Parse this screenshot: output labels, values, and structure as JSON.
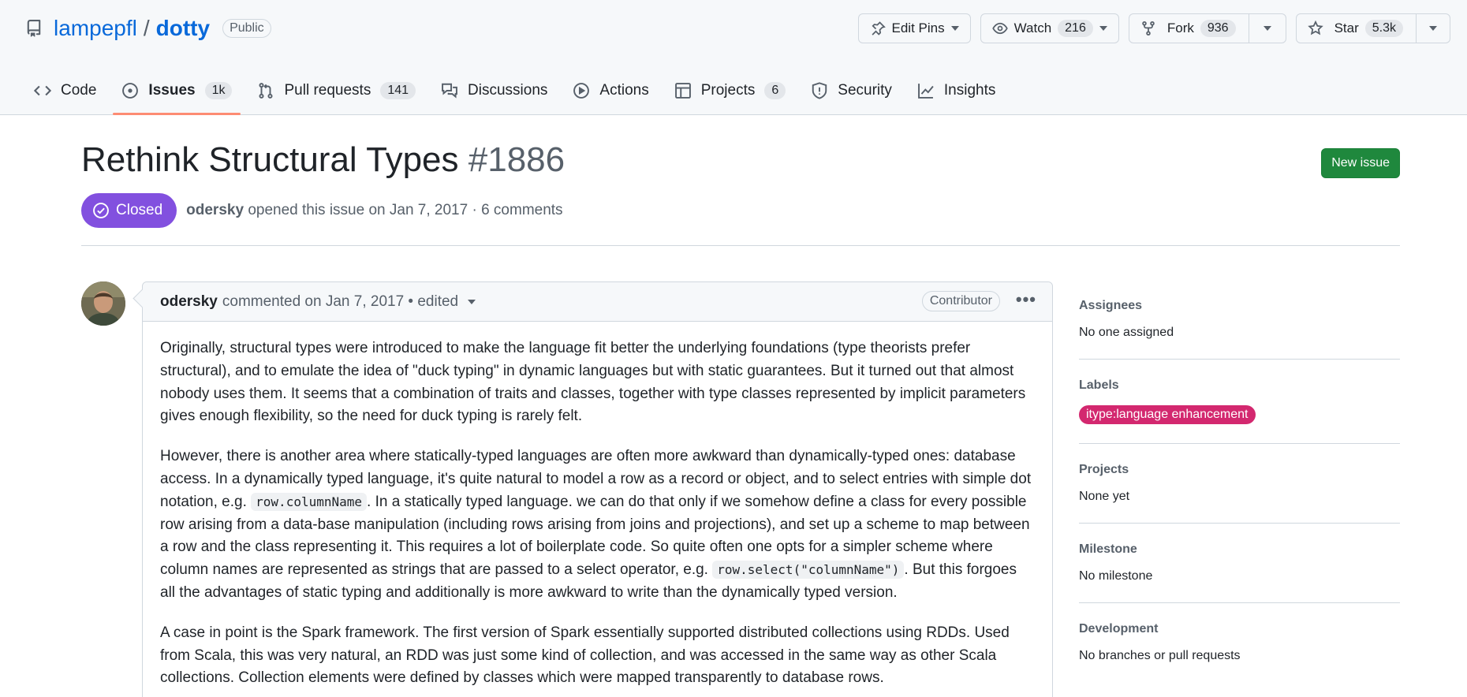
{
  "repo": {
    "owner": "lampepfl",
    "separator": "/",
    "name": "dotty",
    "visibility": "Public"
  },
  "actions": {
    "edit_pins": "Edit Pins",
    "watch_label": "Watch",
    "watch_count": "216",
    "fork_label": "Fork",
    "fork_count": "936",
    "star_label": "Star",
    "star_count": "5.3k"
  },
  "tabs": [
    {
      "label": "Code",
      "icon": "code-icon",
      "count": ""
    },
    {
      "label": "Issues",
      "icon": "issue-opened-icon",
      "count": "1k",
      "active": true
    },
    {
      "label": "Pull requests",
      "icon": "git-pull-request-icon",
      "count": "141"
    },
    {
      "label": "Discussions",
      "icon": "comment-discussion-icon",
      "count": ""
    },
    {
      "label": "Actions",
      "icon": "play-icon",
      "count": ""
    },
    {
      "label": "Projects",
      "icon": "table-icon",
      "count": "6"
    },
    {
      "label": "Security",
      "icon": "shield-icon",
      "count": ""
    },
    {
      "label": "Insights",
      "icon": "graph-icon",
      "count": ""
    }
  ],
  "issue": {
    "title": "Rethink Structural Types",
    "number": "#1886",
    "state": "Closed",
    "author": "odersky",
    "opened_text": "opened this issue on Jan 7, 2017 · 6 comments",
    "new_issue_label": "New issue"
  },
  "comment": {
    "author": "odersky",
    "meta": "commented on Jan 7, 2017 • edited",
    "role": "Contributor",
    "paragraphs": {
      "p1": "Originally, structural types were introduced to make the language fit better the underlying foundations (type theorists prefer structural), and to emulate the idea of \"duck typing\" in dynamic languages but with static guarantees. But it turned out that almost nobody uses them. It seems that a combination of traits and classes, together with type classes represented by implicit parameters gives enough flexibility, so the need for duck typing is rarely felt.",
      "p2a": "However, there is another area where statically-typed languages are often more awkward than dynamically-typed ones: database access. In a dynamically typed language, it's quite natural to model a row as a record or object, and to select entries with simple dot notation, e.g. ",
      "p2_code1": "row.columnName",
      "p2b": ". In a statically typed language. we can do that only if we somehow define a class for every possible row arising from a data-base manipulation (including rows arising from joins and projections), and set up a scheme to map between a row and the class representing it. This requires a lot of boilerplate code. So quite often one opts for a simpler scheme where column names are represented as strings that are passed to a select operator, e.g. ",
      "p2_code2": "row.select(\"columnName\")",
      "p2c": ". But this forgoes all the advantages of static typing and additionally is more awkward to write than the dynamically typed version.",
      "p3": "A case in point is the Spark framework. The first version of Spark essentially supported distributed collections using RDDs. Used from Scala, this was very natural, an RDD was just some kind of collection, and was accessed in the same way as other Scala collections. Collection elements were defined by classes which were mapped transparently to database rows."
    }
  },
  "sidebar": {
    "assignees": {
      "heading": "Assignees",
      "value": "No one assigned"
    },
    "labels": {
      "heading": "Labels",
      "label": "itype:language enhancement",
      "label_color": "#d3286f"
    },
    "projects": {
      "heading": "Projects",
      "value": "None yet"
    },
    "milestone": {
      "heading": "Milestone",
      "value": "No milestone"
    },
    "development": {
      "heading": "Development",
      "value": "No branches or pull requests"
    }
  },
  "colors": {
    "closed_badge": "#8250df",
    "new_issue_button": "#1f883d",
    "link": "#0969da",
    "active_tab_underline": "#fd8c73"
  }
}
